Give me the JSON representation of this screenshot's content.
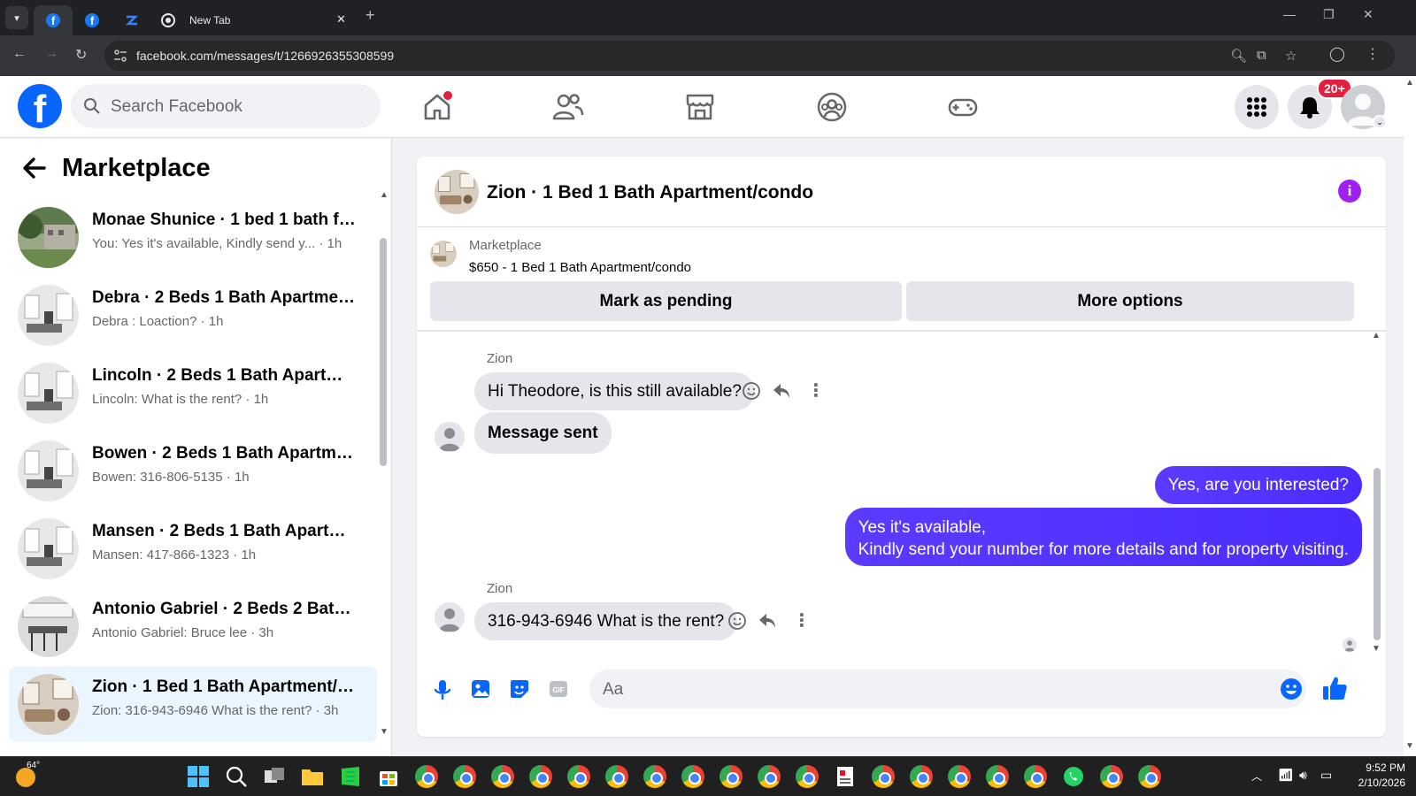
{
  "browser": {
    "tabs": [
      {
        "title": ""
      },
      {
        "title": ""
      },
      {
        "title": ""
      },
      {
        "title": "New Tab"
      }
    ],
    "url": "facebook.com/messages/t/1266926355308599"
  },
  "fb_nav": {
    "search_placeholder": "Search Facebook",
    "notification_badge": "20+"
  },
  "sidebar": {
    "title": "Marketplace",
    "conversations": [
      {
        "name": "Monae Shunice · 1 bed 1 bath for...",
        "preview": "You: Yes it's available, Kindly send y... · 1h"
      },
      {
        "name": "Debra · 2 Beds 1 Bath Apartment...",
        "preview": "Debra : Loaction? · 1h"
      },
      {
        "name": "Lincoln · 2 Beds 1 Bath Apartmen...",
        "preview": "Lincoln: What is the rent? · 1h"
      },
      {
        "name": "Bowen · 2 Beds 1 Bath Apartmen...",
        "preview": "Bowen: 316-806-5135 · 1h"
      },
      {
        "name": "Mansen · 2 Beds 1 Bath Apartme...",
        "preview": "Mansen: 417-866-1323 · 1h"
      },
      {
        "name": "Antonio Gabriel · 2 Beds 2 Baths ...",
        "preview": "Antonio Gabriel: Bruce lee · 3h"
      },
      {
        "name": "Zion · 1 Bed 1 Bath Apartment/co...",
        "preview": "Zion: 316-943-6946 What is the rent? · 3h",
        "selected": true
      }
    ]
  },
  "chat": {
    "title": "Zion · 1 Bed 1 Bath Apartment/condo",
    "marketplace_label": "Marketplace",
    "listing": "$650 - 1 Bed 1 Bath Apartment/condo",
    "mark_pending": "Mark as pending",
    "more_options": "More options",
    "messages": [
      {
        "sender": "Zion",
        "text": "Hi Theodore, is this still available?",
        "dir": "in"
      },
      {
        "text": "Message sent",
        "dir": "in"
      },
      {
        "text": "Yes, are you interested?",
        "dir": "out"
      },
      {
        "text_line1": "Yes it's available,",
        "text_line2": "Kindly send your number for more details and for property visiting.",
        "dir": "out"
      },
      {
        "sender": "Zion",
        "text": "316-943-6946 What is the rent?",
        "dir": "in"
      }
    ],
    "composer_placeholder": "Aa"
  },
  "taskbar": {
    "weather": "64°",
    "time": "9:52 PM",
    "date": "2/10/2026"
  },
  "colors": {
    "fb_blue": "#0866ff",
    "outgoing_bubble": "#4a2cff",
    "info_purple": "#a020f0"
  }
}
